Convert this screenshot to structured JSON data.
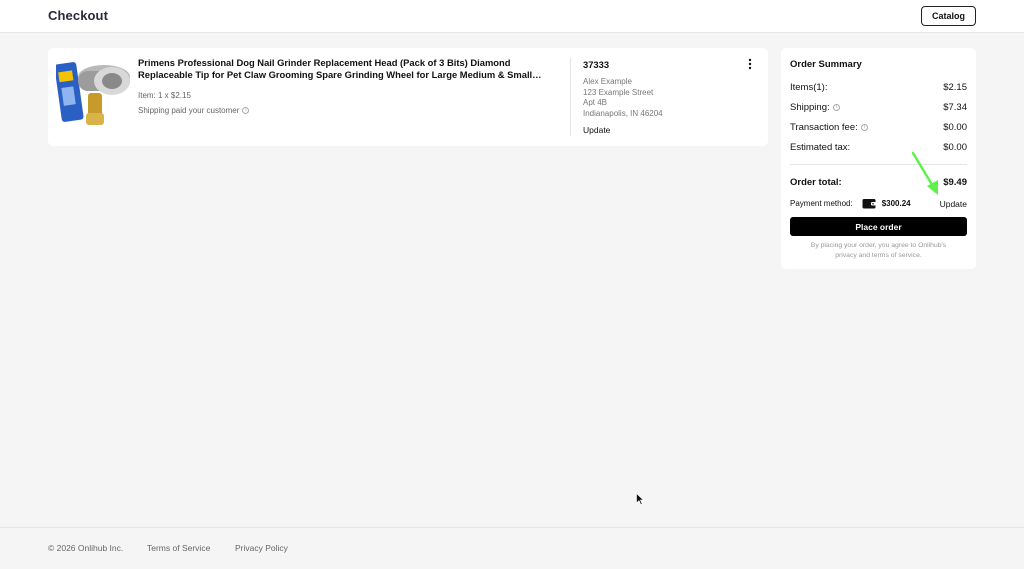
{
  "header": {
    "title": "Checkout",
    "catalog_label": "Catalog"
  },
  "item": {
    "title": "Primens Professional Dog Nail Grinder Replacement Head (Pack of 3 Bits) Diamond Replaceable Tip for Pet Claw Grooming Spare Grinding Wheel for Large Medium & Small Dogs",
    "quantity_text": "Item: 1 x $2.15",
    "shipping_note": "Shipping paid your customer",
    "image_icon": "product-image"
  },
  "address": {
    "id": "37333",
    "name": "Alex Example",
    "street": "123 Example Street",
    "apt": "Apt 4B",
    "city": "Indianapolis, IN 46204",
    "update_label": "Update"
  },
  "summary": {
    "title": "Order Summary",
    "rows": [
      {
        "label": "Items(1):",
        "value": "$2.15"
      },
      {
        "label": "Shipping:",
        "value": "$7.34"
      },
      {
        "label": "Transaction fee:",
        "value": "$0.00"
      },
      {
        "label": "Estimated tax:",
        "value": "$0.00"
      }
    ],
    "total_label": "Order total:",
    "total_value": "$9.49",
    "payment_label": "Payment method:",
    "balance": "$300.24",
    "payment_update_label": "Update",
    "place_order_label": "Place order",
    "agree_line1": "By placing your order, you agree to Onlihub's",
    "agree_line2": "privacy and terms of service.",
    "accent_arrow_color": "#5cf24a"
  },
  "footer": {
    "copyright": "© 2026 Onlihub Inc.",
    "terms": "Terms of Service",
    "privacy": "Privacy Policy"
  }
}
